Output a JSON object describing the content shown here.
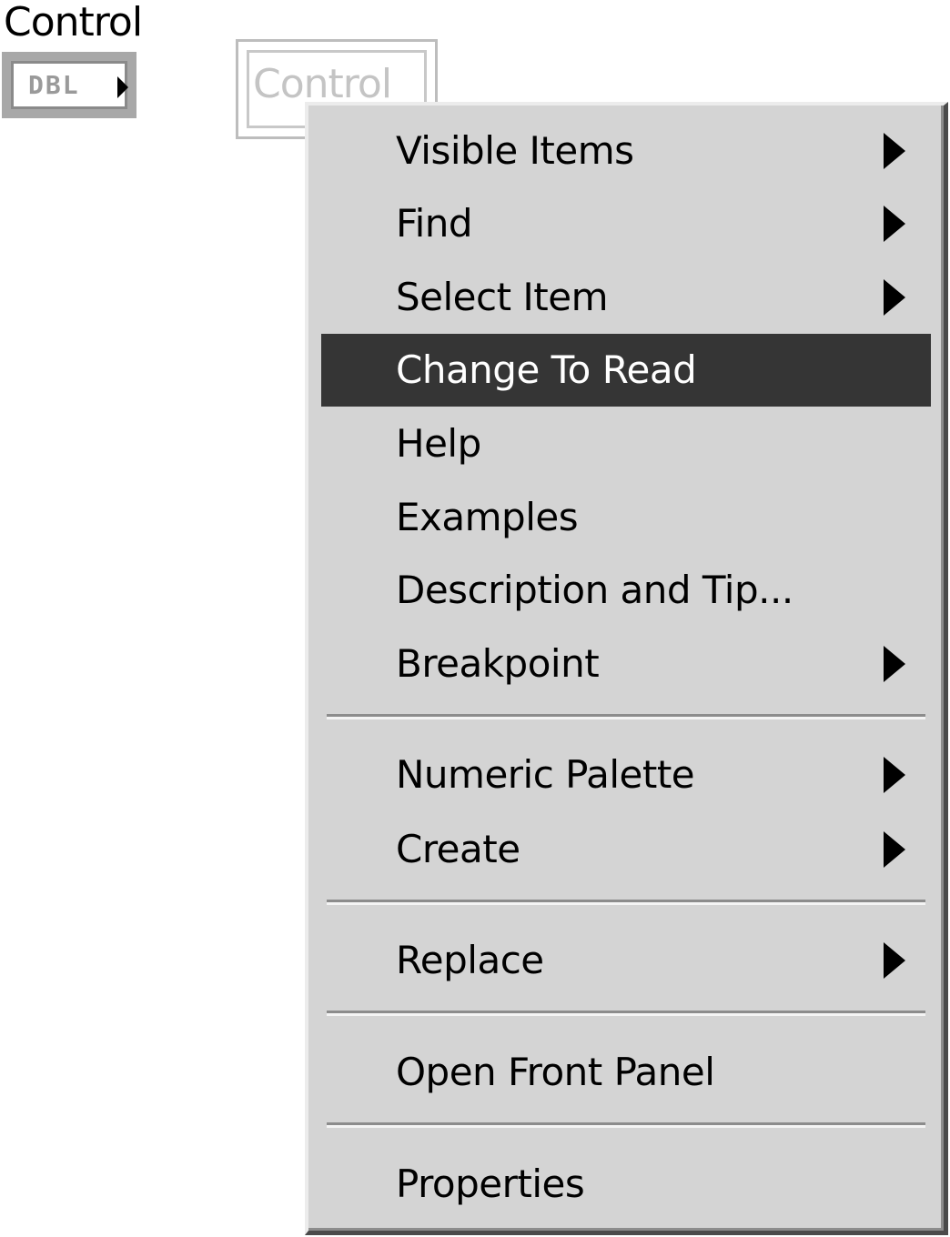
{
  "terminal": {
    "label": "Control",
    "type_text": "DBL"
  },
  "ghost_node": {
    "label": "Control"
  },
  "context_menu": {
    "items": [
      {
        "label": "Visible Items",
        "has_submenu": true
      },
      {
        "label": "Find",
        "has_submenu": true
      },
      {
        "label": "Select Item",
        "has_submenu": true
      },
      {
        "label": "Change To Read",
        "has_submenu": false,
        "highlighted": true
      },
      {
        "label": "Help",
        "has_submenu": false
      },
      {
        "label": "Examples",
        "has_submenu": false
      },
      {
        "label": "Description and Tip...",
        "has_submenu": false
      },
      {
        "label": "Breakpoint",
        "has_submenu": true
      },
      {
        "label": "Numeric Palette",
        "has_submenu": true
      },
      {
        "label": "Create",
        "has_submenu": true
      },
      {
        "label": "Replace",
        "has_submenu": true
      },
      {
        "label": "Open Front Panel",
        "has_submenu": false
      },
      {
        "label": "Properties",
        "has_submenu": false
      }
    ]
  },
  "colors": {
    "menu_background": "#d4d4d4",
    "highlight_background": "#353535",
    "highlight_text": "#ffffff"
  }
}
